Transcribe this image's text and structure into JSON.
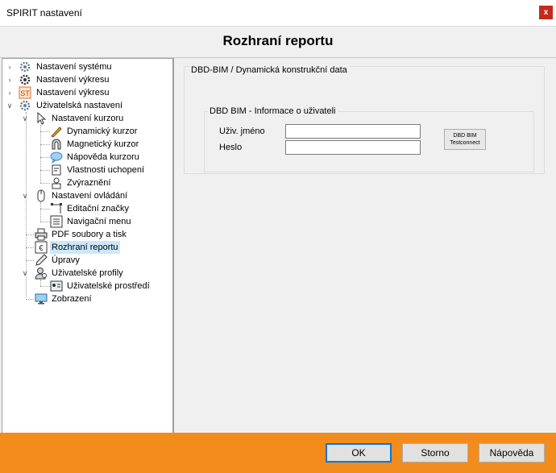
{
  "window": {
    "title": "SPIRIT nastavení",
    "close_glyph": "x"
  },
  "header": {
    "title": "Rozhraní reportu"
  },
  "tree": [
    {
      "label": "Nastavení systému",
      "icon": "gear-icon"
    },
    {
      "label": "Nastavení výkresu",
      "icon": "gear-dark-icon"
    },
    {
      "label": "Nastavení výkresu",
      "icon": "st-icon"
    },
    {
      "label": "Uživatelská nastavení",
      "icon": "gear-icon"
    },
    {
      "label": "Nastavení kurzoru",
      "icon": "cursor-icon"
    },
    {
      "label": "Dynamický kurzor",
      "icon": "pen-icon"
    },
    {
      "label": "Magnetický kurzor",
      "icon": "magnet-icon"
    },
    {
      "label": "Nápověda kurzoru",
      "icon": "speech-bubble-icon"
    },
    {
      "label": "Vlastnosti uchopení",
      "icon": "snap-icon"
    },
    {
      "label": "Zvýraznění",
      "icon": "highlight-icon"
    },
    {
      "label": "Nastavení ovládání",
      "icon": "mouse-icon"
    },
    {
      "label": "Editační značky",
      "icon": "edit-marks-icon"
    },
    {
      "label": "Navigační menu",
      "icon": "nav-menu-icon"
    },
    {
      "label": "PDF soubory a tisk",
      "icon": "printer-icon"
    },
    {
      "label": "Rozhraní reportu",
      "icon": "euro-icon"
    },
    {
      "label": "Úpravy",
      "icon": "pencil-icon"
    },
    {
      "label": "Uživatelské profily",
      "icon": "user-profile-icon"
    },
    {
      "label": "Uživatelské prostředí",
      "icon": "id-card-icon"
    },
    {
      "label": "Zobrazení",
      "icon": "monitor-icon"
    }
  ],
  "panel": {
    "group_title": "DBD-BIM / Dynamická konstrukční data",
    "subgroup_title": "DBD BIM - Informace o uživateli",
    "username_label": "Uživ. jméno",
    "password_label": "Heslo",
    "username_value": "",
    "password_value": "",
    "test_button_line1": "DBD BIM",
    "test_button_line2": "Testconnect"
  },
  "footer": {
    "ok": "OK",
    "cancel": "Storno",
    "help": "Nápověda"
  },
  "colors": {
    "footer": "#f28c1c",
    "selection": "#cce8ff",
    "close": "#c42b1c",
    "focus": "#0078d7"
  }
}
